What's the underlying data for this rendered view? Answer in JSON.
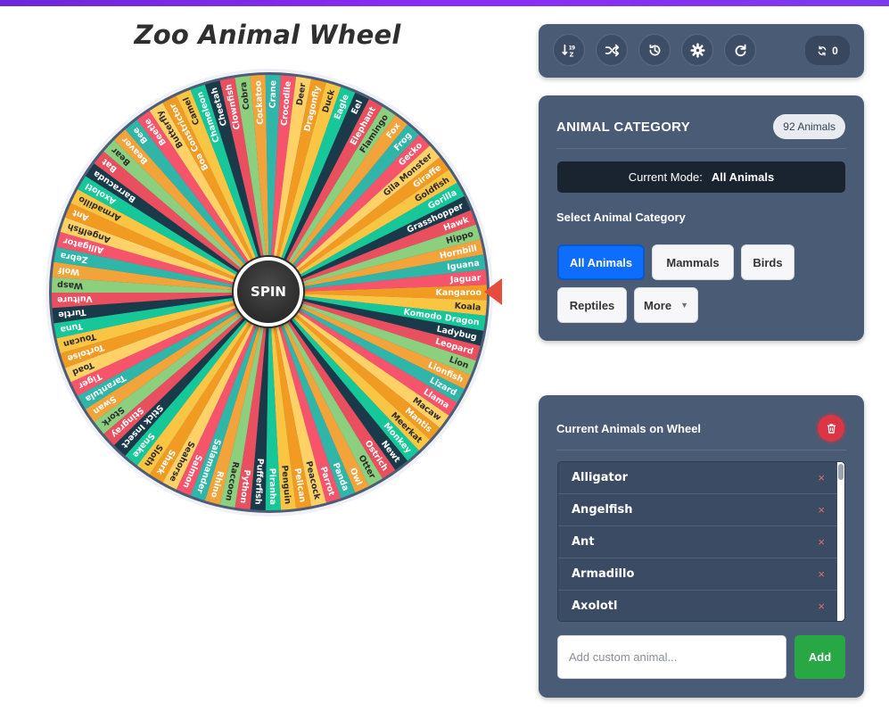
{
  "app": {
    "title": "Zoo Animal Wheel"
  },
  "colors": {
    "accent": "#7c3aed",
    "panel": "#4a5b76",
    "primary": "#0d6efd",
    "danger": "#dc3545",
    "success": "#28a745",
    "pointer": "#e74c3c",
    "wheel_palette": [
      "#f29b23",
      "#fbc544",
      "#16c79a",
      "#1a3a4a",
      "#e94f5f",
      "#8ccf7e",
      "#f2a33a",
      "#2fb6a8",
      "#f6546a",
      "#ffd166"
    ]
  },
  "wheel": {
    "spin_label": "SPIN",
    "segments": [
      "Kangaroo",
      "Koala",
      "Komodo Dragon",
      "Ladybug",
      "Leopard",
      "Lion",
      "Lionfish",
      "Lizard",
      "Llama",
      "Macaw",
      "Mantis",
      "Meerkat",
      "Monkey",
      "Newt",
      "Ostrich",
      "Otter",
      "Owl",
      "Panda",
      "Parrot",
      "Peacock",
      "Pelican",
      "Penguin",
      "Piranha",
      "Pufferfish",
      "Python",
      "Raccoon",
      "Rhino",
      "Salamander",
      "Salmon",
      "Seahorse",
      "Shark",
      "Sloth",
      "Snake",
      "Stick Insect",
      "Stingray",
      "Stork",
      "Swan",
      "Tarantula",
      "Tiger",
      "Toad",
      "Tortoise",
      "Toucan",
      "Tuna",
      "Turtle",
      "Vulture",
      "Wasp",
      "Wolf",
      "Zebra",
      "Alligator",
      "Angelfish",
      "Ant",
      "Armadillo",
      "Axolotl",
      "Barracuda",
      "Bat",
      "Bear",
      "Beaver",
      "Bee",
      "Beetle",
      "Butterfly",
      "Boa Constrictor",
      "Camel",
      "Chameleon",
      "Cheetah",
      "Clownfish",
      "Cobra",
      "Cockatoo",
      "Crane",
      "Crocodile",
      "Deer",
      "Dragonfly",
      "Duck",
      "Eagle",
      "Eel",
      "Elephant",
      "Flamingo",
      "Fox",
      "Frog",
      "Gecko",
      "Gila Monster",
      "Giraffe",
      "Goldfish",
      "Gorilla",
      "Grasshopper",
      "Hawk",
      "Hippo",
      "Hornbill",
      "Iguana",
      "Jaguar"
    ]
  },
  "toolbar": {
    "buttons": [
      {
        "name": "sort",
        "icon": "sort-alpha-icon"
      },
      {
        "name": "shuffle",
        "icon": "shuffle-icon"
      },
      {
        "name": "history",
        "icon": "history-icon"
      },
      {
        "name": "settings",
        "icon": "gear-icon"
      },
      {
        "name": "reset",
        "icon": "redo-icon"
      }
    ],
    "spin_count": "0"
  },
  "category": {
    "title": "ANIMAL CATEGORY",
    "count_badge": "92 Animals",
    "mode_label": "Current Mode:",
    "mode_value": "All Animals",
    "select_label": "Select Animal Category",
    "buttons": [
      "All Animals",
      "Mammals",
      "Birds",
      "Reptiles",
      "More"
    ],
    "active": "All Animals"
  },
  "animals": {
    "title": "Current Animals on Wheel",
    "list": [
      "Alligator",
      "Angelfish",
      "Ant",
      "Armadillo",
      "Axolotl"
    ],
    "remove_symbol": "×",
    "input_placeholder": "Add custom animal...",
    "add_label": "Add"
  }
}
